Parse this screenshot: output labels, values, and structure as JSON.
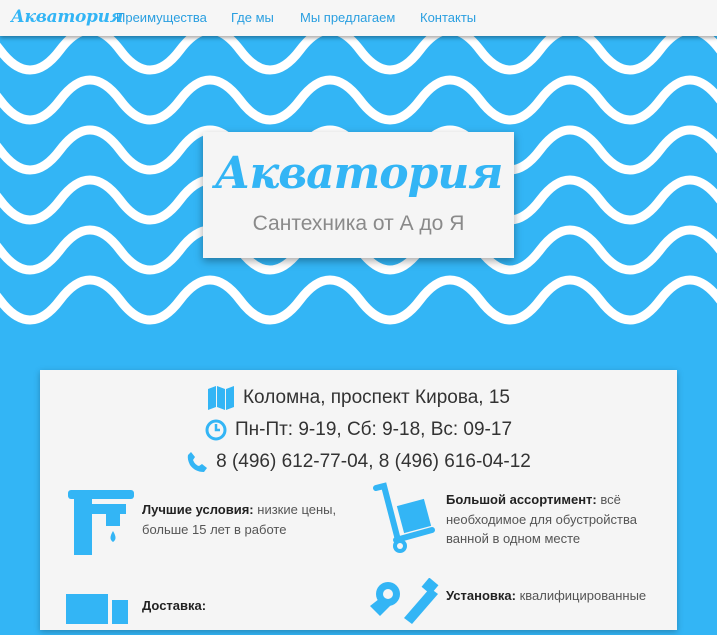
{
  "brand": "Акватория",
  "nav": [
    {
      "label": "Преимущества"
    },
    {
      "label": "Где мы"
    },
    {
      "label": "Мы предлагаем"
    },
    {
      "label": "Контакты"
    }
  ],
  "hero": {
    "title": "Акватория",
    "subtitle": "Сантехника от А до Я"
  },
  "info": {
    "address": "Коломна, проспект Кирова, 15",
    "hours": "Пн-Пт: 9-19, Сб: 9-18, Вс: 09-17",
    "phones": "8 (496) 612-77-04, 8 (496) 616-04-12"
  },
  "features": [
    {
      "title": "Лучшие условия:",
      "text": "низкие цены, больше 15 лет в работе",
      "icon": "faucet-icon"
    },
    {
      "title": "Большой ассортимент:",
      "text": "всё необходимое для обустройства ванной в одном месте",
      "icon": "hand-truck-icon"
    },
    {
      "title": "Доставка:",
      "text": "",
      "icon": "truck-icon"
    },
    {
      "title": "Установка:",
      "text": "квалифицированные",
      "icon": "tools-icon"
    }
  ],
  "colors": {
    "accent": "#33b5f5",
    "link": "#2a9fe0",
    "card": "#f5f5f5"
  }
}
